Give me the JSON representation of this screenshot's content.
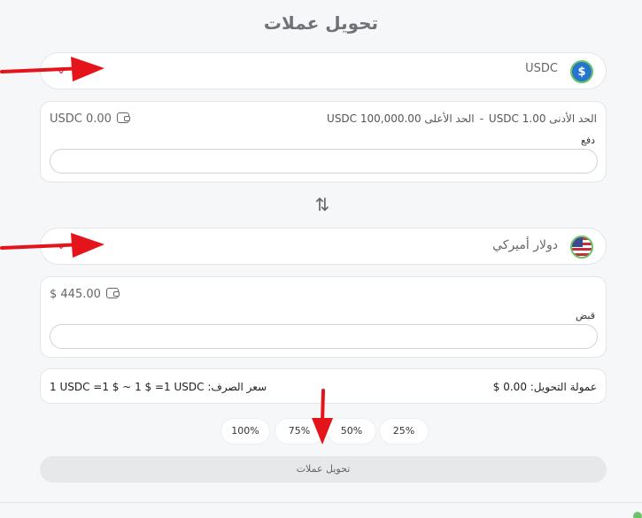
{
  "title": "تحويل عملات",
  "from": {
    "currency": "USDC",
    "coin_glyph": "$",
    "limits_min": "الحد الأدنى  USDC 1.00",
    "limits_sep": "-",
    "limits_max": "الحد الأعلى  USDC 100,000.00",
    "balance": "USDC 0.00",
    "field_label": "دفع",
    "value": ""
  },
  "to": {
    "currency": "دولار أميركي",
    "balance": "$ 445.00",
    "field_label": "قبض",
    "value": ""
  },
  "swap_glyph": "⇅",
  "chevron_glyph": "⌄",
  "fee": "عمولة التحويل: 0.00 $",
  "rate": "1 USDC =1 $ ~ 1 $ =1 USDC :سعر الصرف",
  "percent_buttons": [
    "100%",
    "75%",
    "50%",
    "25%"
  ],
  "submit_label": "تحويل عملات",
  "colors": {
    "arrow": "#e5141b",
    "status_dot": "#6ac46a"
  }
}
